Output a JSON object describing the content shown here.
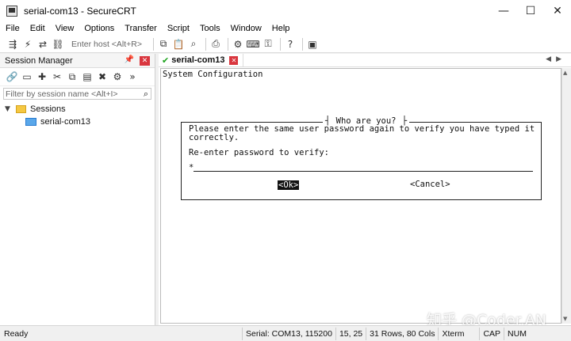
{
  "window": {
    "title": "serial-com13 - SecureCRT",
    "minimize": "—",
    "maximize": "☐",
    "close": "✕"
  },
  "menu": [
    "File",
    "Edit",
    "View",
    "Options",
    "Transfer",
    "Script",
    "Tools",
    "Window",
    "Help"
  ],
  "toolbar": {
    "host_placeholder": "Enter host <Alt+R>"
  },
  "session_manager": {
    "title": "Session Manager",
    "filter_placeholder": "Filter by session name <Alt+I>",
    "tree": {
      "folder": "Sessions",
      "session": "serial-com13"
    }
  },
  "tab": {
    "label": "serial-com13"
  },
  "terminal": {
    "header": "System Configuration",
    "dialog": {
      "title": " Who are you? ",
      "line1": "Please enter the same user password again to verify you have typed it",
      "line2": "correctly.",
      "prompt": "Re-enter password to verify:",
      "password_value": "*",
      "ok_label": "<Ok>",
      "cancel_label": "<Cancel>"
    }
  },
  "watermark": "知乎 @Coder.AN",
  "status": {
    "ready": "Ready",
    "connection": "Serial: COM13, 115200",
    "cursor": "15,  25",
    "size": "31 Rows, 80 Cols",
    "emulation": "Xterm",
    "caps": "CAP",
    "num": "NUM"
  },
  "colors": {
    "close_red": "#d9363e",
    "folder_yellow": "#f5c842",
    "connected_green": "#1aa21a"
  }
}
